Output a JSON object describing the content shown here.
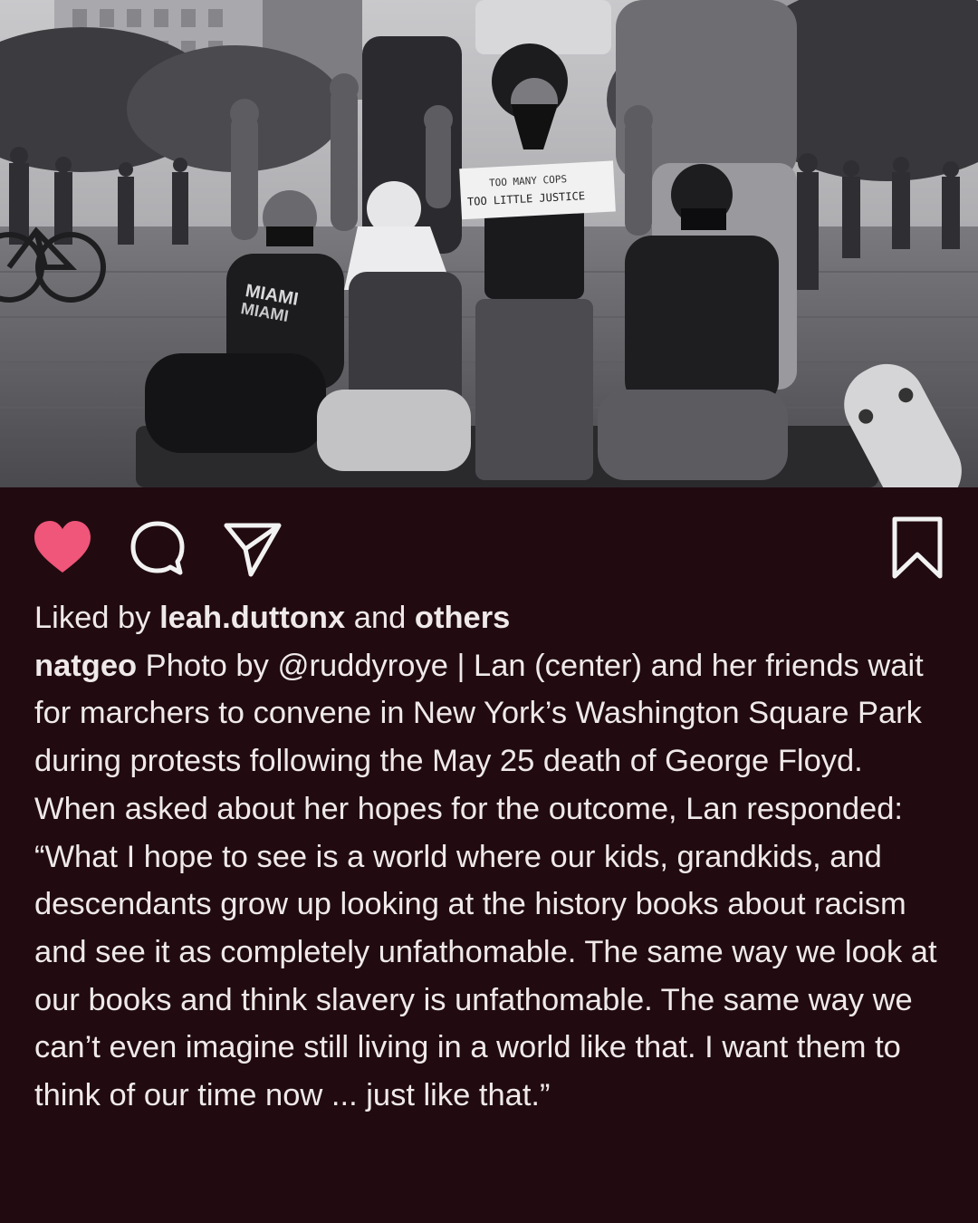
{
  "photo": {
    "alt": "",
    "sign_line_1": "TOO MANY COPS",
    "sign_line_2": "TOO LITTLE JUSTICE",
    "shirt_text_1": "MIAMI",
    "shirt_text_2": "MIAMI"
  },
  "actions": {
    "like_icon": "heart-icon",
    "comment_icon": "comment-icon",
    "share_icon": "paper-plane-icon",
    "save_icon": "bookmark-icon",
    "liked": true,
    "like_color": "#f0557a"
  },
  "likes": {
    "prefix": "Liked by ",
    "user": "leah.duttonx",
    "middle": " and ",
    "others": "others"
  },
  "caption": {
    "username": "natgeo",
    "text": " Photo by @ruddyroye | Lan (center) and her friends wait for marchers to convene in New York’s Washington Square Park during protests following the May 25 death of George Floyd. When asked about her hopes for the outcome, Lan responded: “What I hope to see is a world where our kids, grandkids, and descendants grow up looking at the history books about racism and see it as completely unfathomable. The same way we look at our books and think slavery is unfathomable. The same way we can’t even imagine still living in a world like that. I want them to think of our time now ... just like that.”"
  },
  "colors": {
    "background": "#210b10",
    "text": "#efe9ea",
    "icon_stroke": "#f2f2f2"
  }
}
